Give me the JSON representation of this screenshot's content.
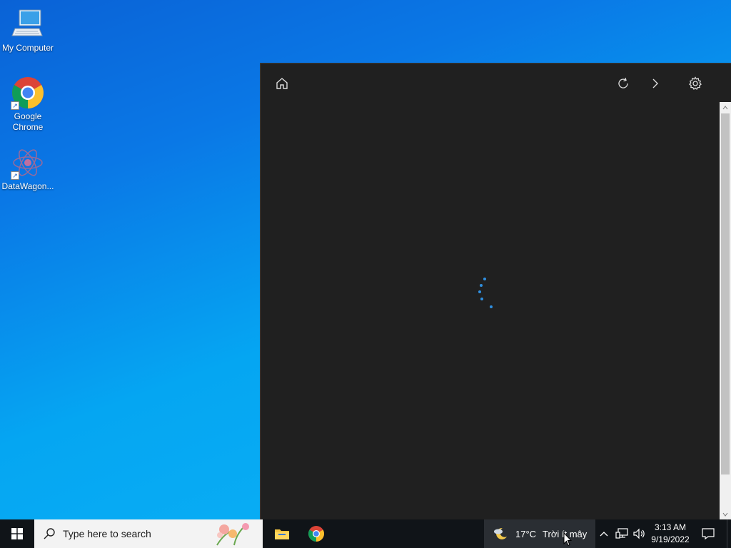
{
  "desktop": {
    "icons": [
      {
        "label": "My Computer"
      },
      {
        "label": "Google Chrome"
      },
      {
        "label": "DataWagon..."
      }
    ]
  },
  "panel": {
    "toolbar": [
      "home-icon",
      "refresh-icon",
      "forward-chevron-icon",
      "gear-icon"
    ],
    "state": "loading",
    "spinner_color": "#2f8fe0"
  },
  "taskbar": {
    "search": {
      "placeholder": "Type here to search"
    },
    "pinned": [
      "file-explorer-icon",
      "chrome-icon"
    ],
    "weather": {
      "temp": "17°C",
      "condition": "Trời ít mây"
    },
    "clock": {
      "time": "3:13 AM",
      "date": "9/19/2022"
    }
  }
}
